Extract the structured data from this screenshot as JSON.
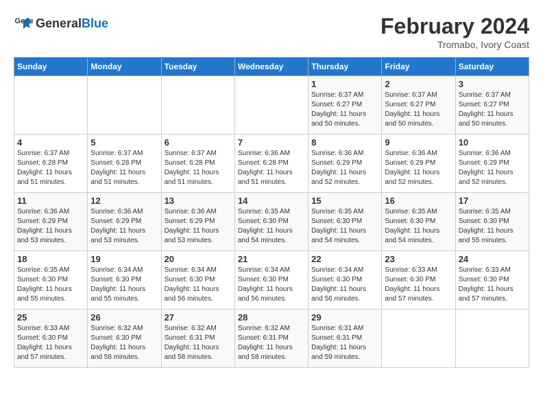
{
  "header": {
    "logo_general": "General",
    "logo_blue": "Blue",
    "month": "February 2024",
    "location": "Tromabo, Ivory Coast"
  },
  "weekdays": [
    "Sunday",
    "Monday",
    "Tuesday",
    "Wednesday",
    "Thursday",
    "Friday",
    "Saturday"
  ],
  "weeks": [
    [
      {
        "day": "",
        "info": ""
      },
      {
        "day": "",
        "info": ""
      },
      {
        "day": "",
        "info": ""
      },
      {
        "day": "",
        "info": ""
      },
      {
        "day": "1",
        "info": "Sunrise: 6:37 AM\nSunset: 6:27 PM\nDaylight: 11 hours\nand 50 minutes."
      },
      {
        "day": "2",
        "info": "Sunrise: 6:37 AM\nSunset: 6:27 PM\nDaylight: 11 hours\nand 50 minutes."
      },
      {
        "day": "3",
        "info": "Sunrise: 6:37 AM\nSunset: 6:27 PM\nDaylight: 11 hours\nand 50 minutes."
      }
    ],
    [
      {
        "day": "4",
        "info": "Sunrise: 6:37 AM\nSunset: 6:28 PM\nDaylight: 11 hours\nand 51 minutes."
      },
      {
        "day": "5",
        "info": "Sunrise: 6:37 AM\nSunset: 6:28 PM\nDaylight: 11 hours\nand 51 minutes."
      },
      {
        "day": "6",
        "info": "Sunrise: 6:37 AM\nSunset: 6:28 PM\nDaylight: 11 hours\nand 51 minutes."
      },
      {
        "day": "7",
        "info": "Sunrise: 6:36 AM\nSunset: 6:28 PM\nDaylight: 11 hours\nand 51 minutes."
      },
      {
        "day": "8",
        "info": "Sunrise: 6:36 AM\nSunset: 6:29 PM\nDaylight: 11 hours\nand 52 minutes."
      },
      {
        "day": "9",
        "info": "Sunrise: 6:36 AM\nSunset: 6:29 PM\nDaylight: 11 hours\nand 52 minutes."
      },
      {
        "day": "10",
        "info": "Sunrise: 6:36 AM\nSunset: 6:29 PM\nDaylight: 11 hours\nand 52 minutes."
      }
    ],
    [
      {
        "day": "11",
        "info": "Sunrise: 6:36 AM\nSunset: 6:29 PM\nDaylight: 11 hours\nand 53 minutes."
      },
      {
        "day": "12",
        "info": "Sunrise: 6:36 AM\nSunset: 6:29 PM\nDaylight: 11 hours\nand 53 minutes."
      },
      {
        "day": "13",
        "info": "Sunrise: 6:36 AM\nSunset: 6:29 PM\nDaylight: 11 hours\nand 53 minutes."
      },
      {
        "day": "14",
        "info": "Sunrise: 6:35 AM\nSunset: 6:30 PM\nDaylight: 11 hours\nand 54 minutes."
      },
      {
        "day": "15",
        "info": "Sunrise: 6:35 AM\nSunset: 6:30 PM\nDaylight: 11 hours\nand 54 minutes."
      },
      {
        "day": "16",
        "info": "Sunrise: 6:35 AM\nSunset: 6:30 PM\nDaylight: 11 hours\nand 54 minutes."
      },
      {
        "day": "17",
        "info": "Sunrise: 6:35 AM\nSunset: 6:30 PM\nDaylight: 11 hours\nand 55 minutes."
      }
    ],
    [
      {
        "day": "18",
        "info": "Sunrise: 6:35 AM\nSunset: 6:30 PM\nDaylight: 11 hours\nand 55 minutes."
      },
      {
        "day": "19",
        "info": "Sunrise: 6:34 AM\nSunset: 6:30 PM\nDaylight: 11 hours\nand 55 minutes."
      },
      {
        "day": "20",
        "info": "Sunrise: 6:34 AM\nSunset: 6:30 PM\nDaylight: 11 hours\nand 56 minutes."
      },
      {
        "day": "21",
        "info": "Sunrise: 6:34 AM\nSunset: 6:30 PM\nDaylight: 11 hours\nand 56 minutes."
      },
      {
        "day": "22",
        "info": "Sunrise: 6:34 AM\nSunset: 6:30 PM\nDaylight: 11 hours\nand 56 minutes."
      },
      {
        "day": "23",
        "info": "Sunrise: 6:33 AM\nSunset: 6:30 PM\nDaylight: 11 hours\nand 57 minutes."
      },
      {
        "day": "24",
        "info": "Sunrise: 6:33 AM\nSunset: 6:30 PM\nDaylight: 11 hours\nand 57 minutes."
      }
    ],
    [
      {
        "day": "25",
        "info": "Sunrise: 6:33 AM\nSunset: 6:30 PM\nDaylight: 11 hours\nand 57 minutes."
      },
      {
        "day": "26",
        "info": "Sunrise: 6:32 AM\nSunset: 6:30 PM\nDaylight: 11 hours\nand 58 minutes."
      },
      {
        "day": "27",
        "info": "Sunrise: 6:32 AM\nSunset: 6:31 PM\nDaylight: 11 hours\nand 58 minutes."
      },
      {
        "day": "28",
        "info": "Sunrise: 6:32 AM\nSunset: 6:31 PM\nDaylight: 11 hours\nand 58 minutes."
      },
      {
        "day": "29",
        "info": "Sunrise: 6:31 AM\nSunset: 6:31 PM\nDaylight: 11 hours\nand 59 minutes."
      },
      {
        "day": "",
        "info": ""
      },
      {
        "day": "",
        "info": ""
      }
    ]
  ]
}
